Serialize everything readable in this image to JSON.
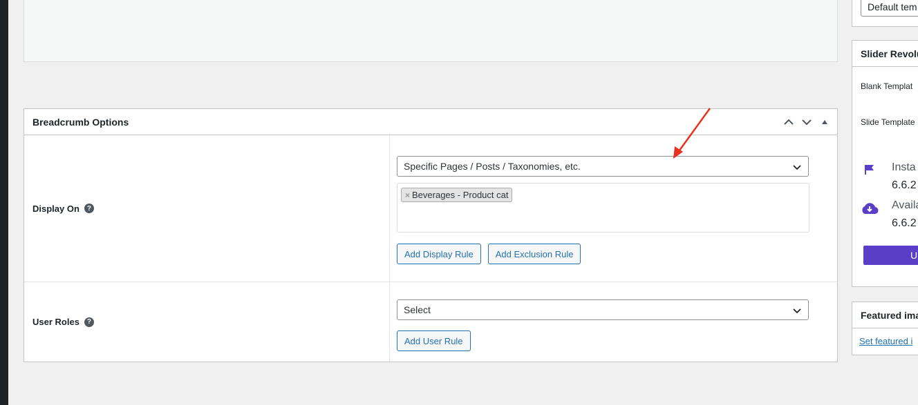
{
  "sidebar_template": {
    "value": "Default tem"
  },
  "slider_box": {
    "title": "Slider Revolu",
    "blank_template": "Blank Templat",
    "slide_template": "Slide Template",
    "installed_label": "Insta",
    "installed_version": "6.6.2",
    "available_label": "Availa",
    "available_version": "6.6.2",
    "update_button": "Ur",
    "accent_color": "#5b3ec8"
  },
  "featured_box": {
    "title": "Featured ima",
    "link": "Set featured i"
  },
  "breadcrumb": {
    "title": "Breadcrumb Options",
    "display_on": {
      "label": "Display On",
      "help": "?",
      "select_value": "Specific Pages / Posts / Taxonomies, etc.",
      "tags": [
        {
          "label": "Beverages - Product cat",
          "remove": "×"
        }
      ],
      "add_display_rule": "Add Display Rule",
      "add_exclusion_rule": "Add Exclusion Rule"
    },
    "user_roles": {
      "label": "User Roles",
      "help": "?",
      "select_value": "Select",
      "add_user_rule": "Add User Rule"
    }
  },
  "icons": [
    "chevron-up-icon",
    "chevron-down-icon",
    "triangle-up-icon",
    "flag-icon",
    "cloud-download-icon",
    "help-icon",
    "remove-tag-icon"
  ],
  "colors": {
    "link": "#2271b1",
    "annotation_arrow": "#e8321f"
  }
}
